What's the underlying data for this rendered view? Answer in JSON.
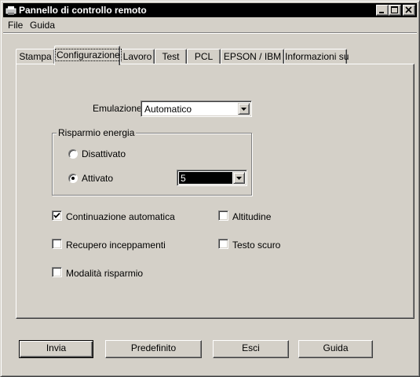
{
  "window": {
    "title": "Pannello di controllo remoto",
    "icon": "printer-icon"
  },
  "menu": [
    "File",
    "Guida"
  ],
  "tabs": [
    "Stampa",
    "Configurazione",
    "Lavoro",
    "Test",
    "PCL",
    "EPSON / IBM",
    "Informazioni su"
  ],
  "active_tab": "Configurazione",
  "emulation": {
    "label": "Emulazione:",
    "value": "Automatico"
  },
  "power_saving": {
    "legend": "Risparmio energia",
    "off_label": "Disattivato",
    "on_label": "Attivato",
    "selected": "Attivato",
    "minutes_value": "5"
  },
  "checkboxes": [
    {
      "label": "Continuazione automatica",
      "checked": true
    },
    {
      "label": "Altitudine",
      "checked": false
    },
    {
      "label": "Recupero inceppamenti",
      "checked": false
    },
    {
      "label": "Testo scuro",
      "checked": false
    },
    {
      "label": "Modalità risparmio",
      "checked": false
    }
  ],
  "buttons": [
    "Invia",
    "Predefinito",
    "Esci",
    "Guida"
  ]
}
